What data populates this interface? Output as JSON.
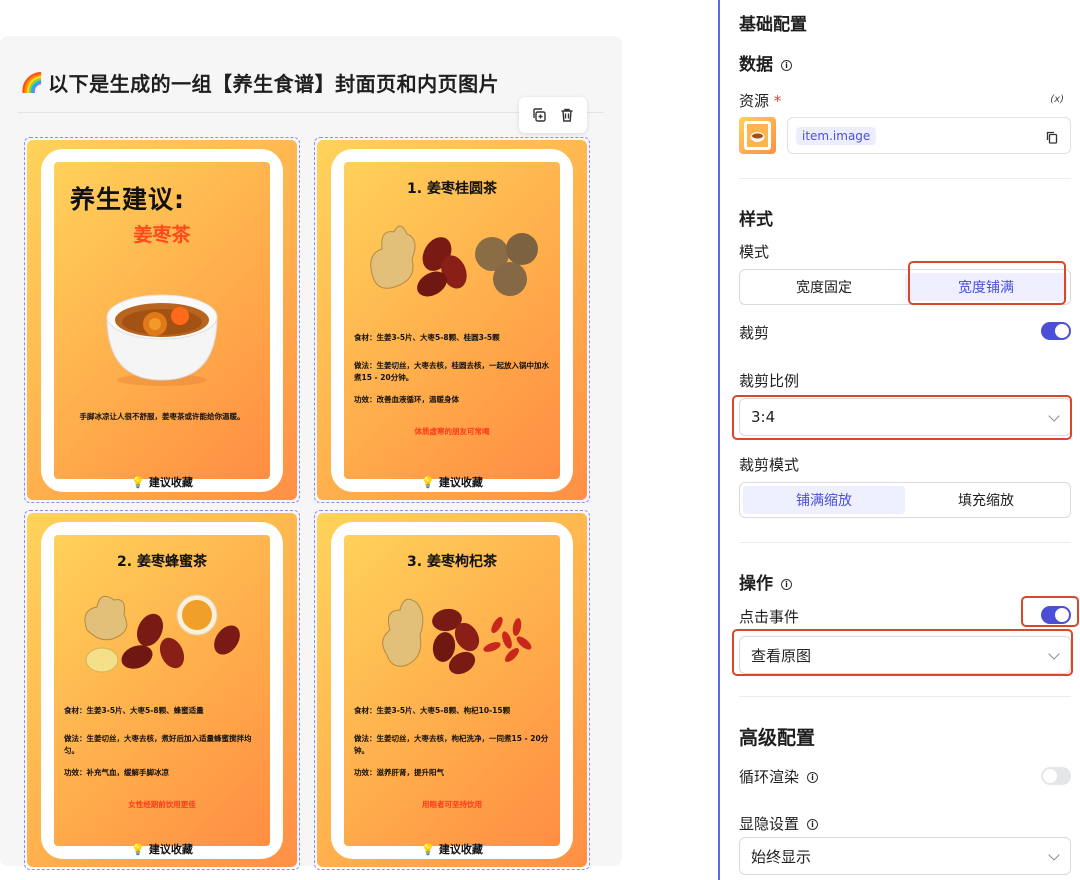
{
  "preview": {
    "heading_emoji": "🌈",
    "heading": "以下是生成的一组【养生食谱】封面页和内页图片",
    "toolbar": {
      "copy_icon": "copy-icon",
      "delete_icon": "trash-icon"
    },
    "cards": [
      {
        "type": "cover",
        "title": "养生建议:",
        "subtitle": "姜枣茶",
        "desc": "手脚冰凉让人很不舒服，姜枣茶或许能给你温暖。",
        "save_label": "建议收藏"
      },
      {
        "type": "recipe",
        "title": "1. 姜枣桂圆茶",
        "ingredients": "食材：生姜3-5片、大枣5-8颗、桂圆3-5颗",
        "method": "做法：生姜切丝，大枣去核，桂圆去核，一起放入锅中加水煮15 - 20分钟。",
        "effect": "功效：改善血液循环，温暖身体",
        "tip": "体质虚寒的朋友可常喝",
        "save_label": "建议收藏"
      },
      {
        "type": "recipe",
        "title": "2. 姜枣蜂蜜茶",
        "ingredients": "食材：生姜3-5片、大枣5-8颗、蜂蜜适量",
        "method": "做法：生姜切丝，大枣去核，煮好后加入适量蜂蜜搅拌均匀。",
        "effect": "功效：补充气血，缓解手脚冰凉",
        "tip": "女性经期前饮用更佳",
        "save_label": "建议收藏"
      },
      {
        "type": "recipe",
        "title": "3. 姜枣枸杞茶",
        "ingredients": "食材：生姜3-5片、大枣5-8颗、枸杞10-15颗",
        "method": "做法：生姜切丝，大枣去核，枸杞洗净，一同煮15 - 20分钟。",
        "effect": "功效：滋养肝肾，提升阳气",
        "tip": "用眼者可坚持饮用",
        "save_label": "建议收藏"
      }
    ]
  },
  "panel": {
    "basic_title": "基础配置",
    "data_label": "数据",
    "resource_label": "资源",
    "required_mark": "*",
    "var_icon_text": "(x)",
    "resource_value": "item.image",
    "style_title": "样式",
    "mode_label": "模式",
    "mode_options": [
      "宽度固定",
      "宽度铺满"
    ],
    "mode_selected": "宽度铺满",
    "crop_label": "裁剪",
    "crop_on": true,
    "crop_ratio_label": "裁剪比例",
    "crop_ratio_value": "3:4",
    "crop_mode_label": "裁剪模式",
    "crop_mode_options": [
      "铺满缩放",
      "填充缩放"
    ],
    "crop_mode_selected": "铺满缩放",
    "action_title": "操作",
    "click_event_label": "点击事件",
    "click_event_on": true,
    "click_event_value": "查看原图",
    "advanced_title": "高级配置",
    "loop_label": "循环渲染",
    "loop_on": false,
    "visibility_label": "显隐设置",
    "visibility_value": "始终显示",
    "colors": {
      "accent": "#4b4fd6",
      "highlight_border": "#d8472b",
      "divider": "#5b66e8",
      "required": "#e8423b"
    }
  }
}
